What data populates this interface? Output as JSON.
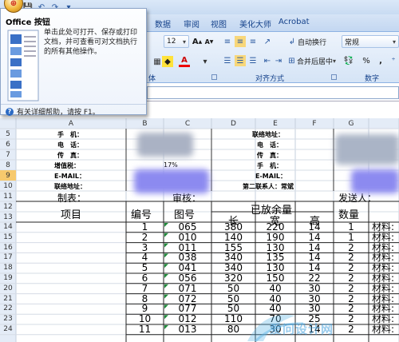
{
  "tabs": {
    "data": "数据",
    "review": "审阅",
    "view": "视图",
    "beautify": "美化大师",
    "acrobat": "Acrobat"
  },
  "ribbon": {
    "font_size": "12",
    "wrap_text": "自动换行",
    "merge_center": "合并后居中",
    "number_format": "常规",
    "percent": "%",
    "comma": ",",
    "group_font_partial": "体",
    "group_alignment": "对齐方式",
    "group_number": "数字"
  },
  "office_popup": {
    "title": "Office 按钮",
    "description": "单击此处可打开、保存或打印文档，并可查看可对文档执行的所有其他操作。",
    "help": "有关详细帮助，请按 F1。"
  },
  "columns": [
    "A",
    "B",
    "C",
    "D",
    "E",
    "F",
    "G"
  ],
  "rows": {
    "r5": {
      "num": "5",
      "a": "手　机：",
      "d": "联络地址："
    },
    "r6": {
      "num": "6",
      "a": "电　话：",
      "d": "电　话："
    },
    "r7": {
      "num": "7",
      "a": "传　真：",
      "d": "传　真："
    },
    "r8": {
      "num": "8",
      "a": "增值税：",
      "b": "17%",
      "d": "手　机："
    },
    "r9": {
      "num": "9",
      "a": "E-MAIL：",
      "d": "E-MAIL："
    },
    "r10": {
      "num": "10",
      "a": "联络地址：",
      "d": "第二联系人：常斌"
    },
    "r11": {
      "num": "11",
      "a": "制表：",
      "c": "审核：",
      "g": "发送人："
    },
    "r12": {
      "num": "12",
      "a": "项目",
      "b": "编号",
      "c": "图号",
      "e": "已放余量",
      "g": "数量"
    },
    "r13": {
      "num": "13",
      "d": "长",
      "e": "宽",
      "f": "高"
    }
  },
  "items": [
    {
      "row": "14",
      "no": "1",
      "fig": "065",
      "len": "380",
      "wid": "220",
      "hei": "14",
      "qty": "1",
      "mat": "材料:"
    },
    {
      "row": "15",
      "no": "2",
      "fig": "010",
      "len": "140",
      "wid": "190",
      "hei": "14",
      "qty": "1",
      "mat": "材料:"
    },
    {
      "row": "16",
      "no": "3",
      "fig": "011",
      "len": "155",
      "wid": "130",
      "hei": "14",
      "qty": "2",
      "mat": "材料:"
    },
    {
      "row": "17",
      "no": "4",
      "fig": "038",
      "len": "340",
      "wid": "135",
      "hei": "14",
      "qty": "2",
      "mat": "材料:"
    },
    {
      "row": "18",
      "no": "5",
      "fig": "041",
      "len": "340",
      "wid": "130",
      "hei": "14",
      "qty": "2",
      "mat": "材料:"
    },
    {
      "row": "19",
      "no": "6",
      "fig": "056",
      "len": "320",
      "wid": "150",
      "hei": "22",
      "qty": "2",
      "mat": "材料:"
    },
    {
      "row": "20",
      "no": "7",
      "fig": "071",
      "len": "50",
      "wid": "40",
      "hei": "30",
      "qty": "2",
      "mat": "材料:"
    },
    {
      "row": "21",
      "no": "8",
      "fig": "072",
      "len": "50",
      "wid": "40",
      "hei": "30",
      "qty": "2",
      "mat": "材料:"
    },
    {
      "row": "22",
      "no": "9",
      "fig": "077",
      "len": "50",
      "wid": "40",
      "hei": "30",
      "qty": "2",
      "mat": "材料:"
    },
    {
      "row": "23",
      "no": "10",
      "fig": "012",
      "len": "110",
      "wid": "70",
      "hei": "25",
      "qty": "2",
      "mat": "材料:"
    },
    {
      "row": "24",
      "no": "11",
      "fig": "013",
      "len": "80",
      "wid": "30",
      "hei": "14",
      "qty": "2",
      "mat": "材料:"
    }
  ],
  "watermark": "爱问设计网",
  "colors": {
    "ribbon_text": "#15428b",
    "header_bg": "#e4ecf7",
    "selected_header": "#f7c96d",
    "grid": "#d0d7e5"
  }
}
